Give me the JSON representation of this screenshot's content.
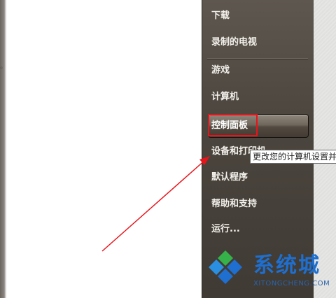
{
  "left_edge_mark": "。",
  "menu": {
    "items": [
      {
        "label": "下载"
      },
      {
        "label": "录制的电视"
      },
      {
        "label": "游戏"
      },
      {
        "label": "计算机"
      },
      {
        "label": "控制面板"
      },
      {
        "label": "设备和打印机"
      },
      {
        "label": "默认程序"
      },
      {
        "label": "帮助和支持"
      },
      {
        "label": "运行..."
      }
    ]
  },
  "tooltip": {
    "text": "更改您的计算机设置并"
  },
  "colors": {
    "annotation_red": "#e8141b",
    "watermark_blue": "#1e6fcf",
    "watermark_green": "#35b34a"
  },
  "watermark": {
    "title": "系统城",
    "url": "XITONGCHENG.COM",
    "logo_icon": "windows-diamond-logo-icon"
  }
}
